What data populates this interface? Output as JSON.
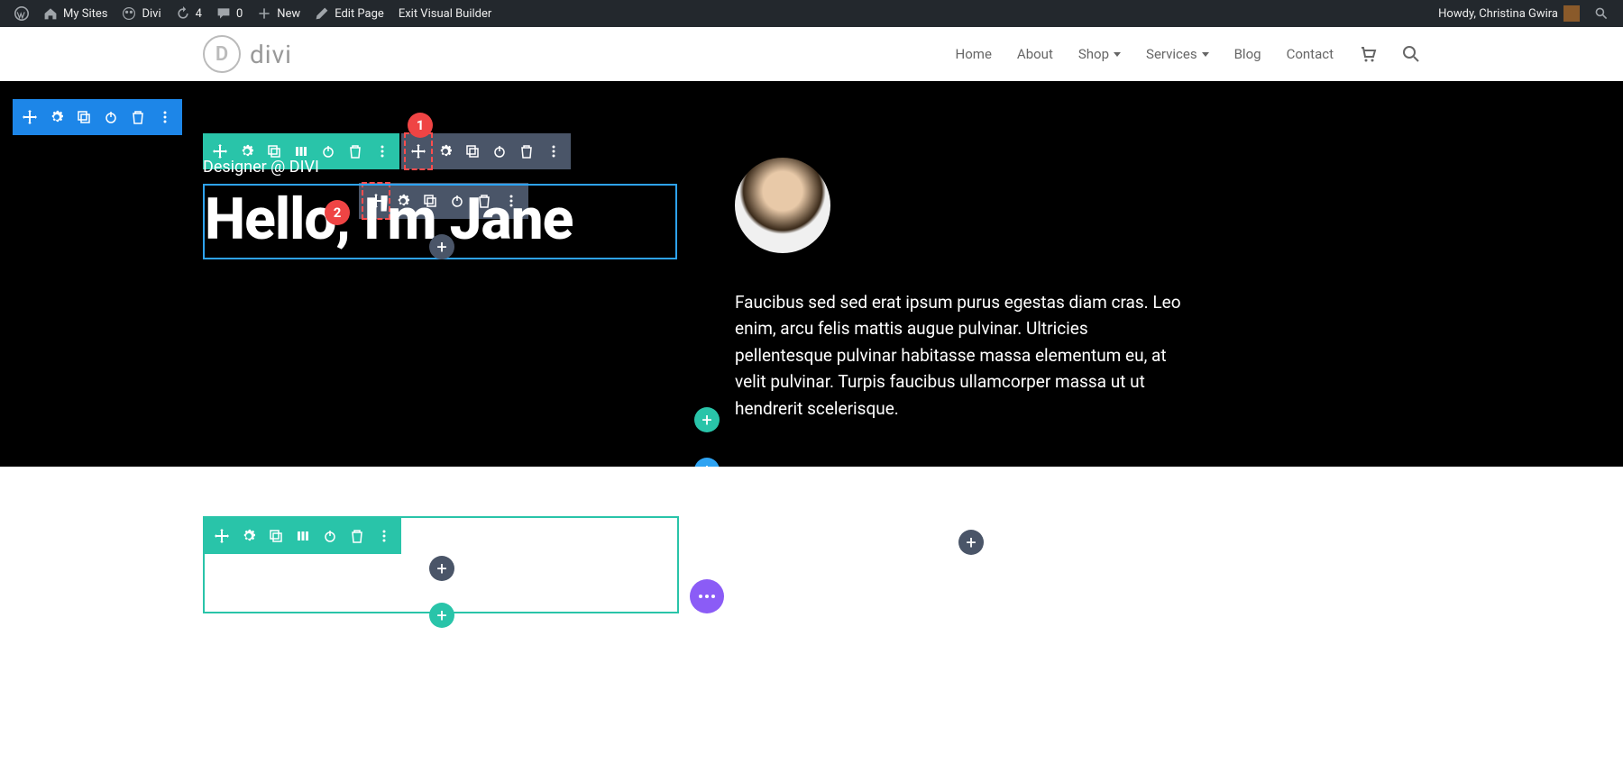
{
  "adminbar": {
    "my_sites": "My Sites",
    "site_name": "Divi",
    "updates": "4",
    "comments": "0",
    "new": "New",
    "edit_page": "Edit Page",
    "exit_vb": "Exit Visual Builder",
    "howdy": "Howdy, Christina Gwira"
  },
  "header": {
    "logo_letter": "D",
    "logo_text": "divi",
    "nav": {
      "home": "Home",
      "about": "About",
      "shop": "Shop",
      "services": "Services",
      "blog": "Blog",
      "contact": "Contact"
    }
  },
  "hero": {
    "subtitle": "Designer @ DIVI",
    "headline": "Hello, I'm Jane",
    "bio": "Faucibus sed sed erat ipsum purus egestas diam cras. Leo enim, arcu felis mattis augue pulvinar. Ultricies pellentesque pulvinar habitasse massa elementum eu, at velit pulvinar. Turpis faucibus ullamcorper massa ut ut hendrerit scelerisque."
  },
  "callouts": {
    "one": "1",
    "two": "2"
  }
}
